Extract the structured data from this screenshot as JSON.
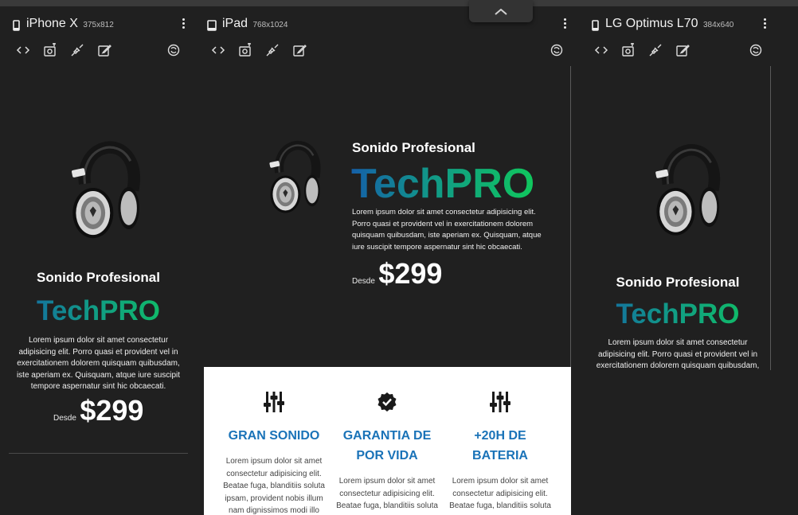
{
  "devices": [
    {
      "name": "iPhone X",
      "resolution": "375x812"
    },
    {
      "name": "iPad",
      "resolution": "768x1024"
    },
    {
      "name": "LG Optimus L70",
      "resolution": "384x640"
    }
  ],
  "icons": {
    "code": "code-icon",
    "screenshot": "camera-icon",
    "network": "plug-icon",
    "edit": "edit-icon",
    "rotate": "rotate-icon",
    "menu": "kebab-menu-icon",
    "collapse": "chevron-up-icon"
  },
  "hero": {
    "subtitle": "Sonido Profesional",
    "brand": "TechPRO",
    "description": "Lorem ipsum dolor sit amet consectetur adipisicing elit. Porro quasi et provident vel in exercitationem dolorem quisquam quibusdam, iste aperiam ex. Quisquam, atque iure suscipit tempore aspernatur sint hic obcaecati.",
    "price_prefix": "Desde",
    "price": "$299"
  },
  "phone_lines": [
    "Lorem ipsum dolor sit amet consectetur",
    "adipisicing elit. Porro quasi et provident vel in",
    "exercitationem dolorem quisquam quibusdam,",
    "iste aperiam ex. Quisquam, atque iure suscipit",
    "tempore aspernatur sint hic obcaecati."
  ],
  "ipad_lines": [
    "Lorem ipsum dolor sit amet consectetur adipisicing elit.",
    "Porro quasi et provident vel in exercitationem dolorem",
    "quisquam quibusdam, iste aperiam ex. Quisquam, atque",
    "iure suscipit tempore aspernatur sint hic obcaecati."
  ],
  "lg_lines": [
    "Lorem ipsum dolor sit amet consectetur",
    "adipisicing elit. Porro quasi et provident vel in",
    "exercitationem dolorem quisquam quibusdam,"
  ],
  "features": [
    {
      "icon": "sliders-icon",
      "title_lines": [
        "GRAN SONIDO"
      ],
      "text_lines": [
        "Lorem ipsum dolor sit amet",
        "consectetur adipisicing elit.",
        "Beatae fuga, blanditiis soluta",
        "ipsam, provident nobis illum",
        "nam dignissimos modi illo"
      ]
    },
    {
      "icon": "check-badge-icon",
      "title_lines": [
        "GARANTIA DE",
        "POR VIDA"
      ],
      "text_lines": [
        "Lorem ipsum dolor sit amet",
        "consectetur adipisicing elit.",
        "Beatae fuga, blanditiis soluta"
      ]
    },
    {
      "icon": "sliders-icon",
      "title_lines": [
        "+20H DE",
        "BATERIA"
      ],
      "text_lines": [
        "Lorem ipsum dolor sit amet",
        "consectetur adipisicing elit.",
        "Beatae fuga, blanditiis soluta"
      ]
    }
  ],
  "colors": {
    "background": "#202020",
    "brand_gradient": [
      "#1560a8",
      "#10c75d"
    ],
    "feature_title": "#1a73b8"
  }
}
